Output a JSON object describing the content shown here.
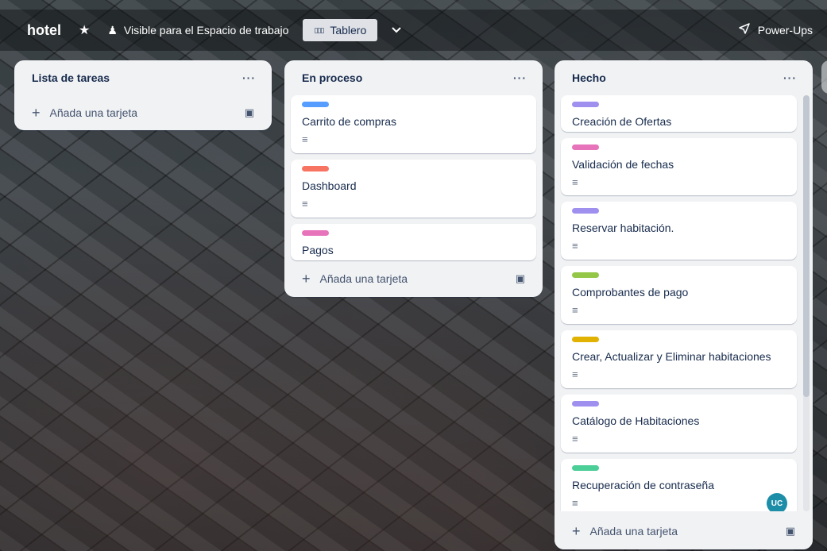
{
  "header": {
    "board_title": "hotel",
    "star_icon": "star-icon",
    "visibility_label": "Visible para el Espacio de trabajo",
    "view_label": "Tablero",
    "power_ups_label": "Power-Ups"
  },
  "lists": [
    {
      "title": "Lista de tareas",
      "menu": "···",
      "add_label": "Añada una tarjeta",
      "cards": []
    },
    {
      "title": "En proceso",
      "menu": "···",
      "add_label": "Añada una tarjeta",
      "cards": [
        {
          "title": "Carrito de compras",
          "label_color": "#579dff",
          "has_description": true
        },
        {
          "title": "Dashboard",
          "label_color": "#f87462",
          "has_description": true
        },
        {
          "title": "Pagos",
          "label_color": "#e774bb",
          "has_description": false
        }
      ]
    },
    {
      "title": "Hecho",
      "menu": "···",
      "add_label": "Añada una tarjeta",
      "cards": [
        {
          "title": "Creación de Ofertas",
          "label_color": "#9f8fef",
          "has_description": false
        },
        {
          "title": "Validación de fechas",
          "label_color": "#e774bb",
          "has_description": true
        },
        {
          "title": "Reservar habitación.",
          "label_color": "#9f8fef",
          "has_description": true
        },
        {
          "title": "Comprobantes de pago",
          "label_color": "#94c748",
          "has_description": true
        },
        {
          "title": "Crear, Actualizar y Eliminar habitaciones",
          "label_color": "#e2b203",
          "has_description": true
        },
        {
          "title": "Catálogo de Habitaciones",
          "label_color": "#9f8fef",
          "has_description": true
        },
        {
          "title": "Recuperación de contraseña",
          "label_color": "#4bce97",
          "has_description": true,
          "avatar": "UC"
        }
      ]
    }
  ]
}
